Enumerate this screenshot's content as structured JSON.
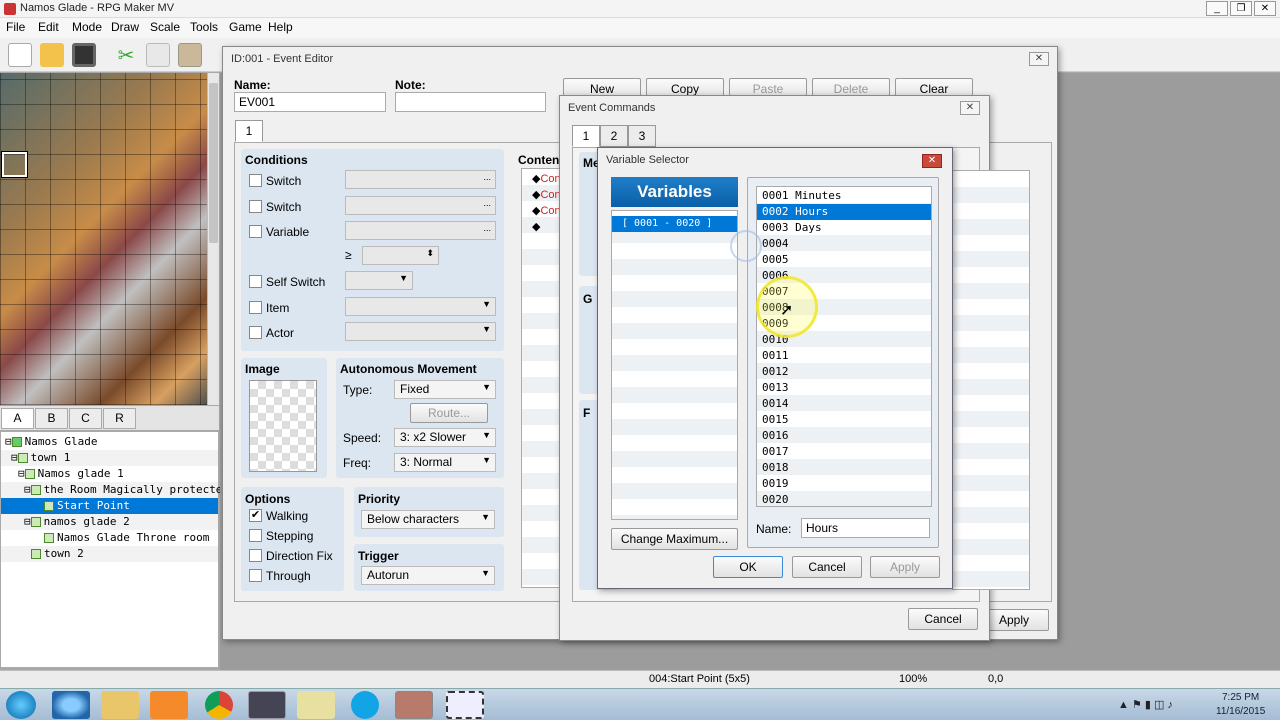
{
  "app": {
    "title": "Namos Glade - RPG Maker MV"
  },
  "menu": [
    "File",
    "Edit",
    "Mode",
    "Draw",
    "Scale",
    "Tools",
    "Game",
    "Help"
  ],
  "tileset_tabs": [
    "A",
    "B",
    "C",
    "R"
  ],
  "map_tree": [
    {
      "label": "Namos Glade",
      "depth": 0
    },
    {
      "label": "town 1",
      "depth": 1
    },
    {
      "label": "Namos glade 1",
      "depth": 2
    },
    {
      "label": "the Room Magically protected",
      "depth": 3
    },
    {
      "label": "Start Point",
      "depth": 4,
      "selected": true
    },
    {
      "label": "namos glade 2",
      "depth": 3
    },
    {
      "label": "Namos Glade Throne room",
      "depth": 4
    },
    {
      "label": "town 2",
      "depth": 2
    }
  ],
  "status": {
    "event": "004:Start Point (5x5)",
    "zoom": "100%",
    "coords": "0,0"
  },
  "clock": {
    "time": "7:25 PM",
    "date": "11/16/2015"
  },
  "event_editor": {
    "title": "ID:001 - Event Editor",
    "name_label": "Name:",
    "name_value": "EV001",
    "note_label": "Note:",
    "note_value": "",
    "buttons": {
      "new": "New",
      "copy": "Copy",
      "paste": "Paste",
      "delete": "Delete",
      "clear": "Clear"
    },
    "page_tab": "1",
    "conditions_title": "Conditions",
    "conditions": [
      "Switch",
      "Switch",
      "Variable",
      "Self Switch",
      "Item",
      "Actor"
    ],
    "ellipsis": "...",
    "gte": "≥",
    "image_title": "Image",
    "autonomous_title": "Autonomous Movement",
    "type_label": "Type:",
    "type_value": "Fixed",
    "route_button": "Route...",
    "speed_label": "Speed:",
    "speed_value": "3: x2 Slower",
    "freq_label": "Freq:",
    "freq_value": "3: Normal",
    "options_title": "Options",
    "options": [
      {
        "label": "Walking",
        "checked": true
      },
      {
        "label": "Stepping",
        "checked": false
      },
      {
        "label": "Direction Fix",
        "checked": false
      },
      {
        "label": "Through",
        "checked": false
      }
    ],
    "priority_title": "Priority",
    "priority_value": "Below characters",
    "trigger_title": "Trigger",
    "trigger_value": "Autorun",
    "contents_title": "Contents",
    "contents": [
      "Con",
      "Con",
      "Con",
      ""
    ],
    "apply_button": "Apply"
  },
  "event_commands": {
    "title": "Event Commands",
    "tabs": [
      "1",
      "2",
      "3"
    ],
    "section_labels": [
      "Me",
      "G",
      "F"
    ],
    "cancel_button": "Cancel"
  },
  "variable_selector": {
    "title": "Variable Selector",
    "header": "Variables",
    "groups": [
      "[ 0001 - 0020 ]"
    ],
    "change_max_button": "Change Maximum...",
    "items": [
      "0001 Minutes",
      "0002 Hours",
      "0003 Days",
      "0004",
      "0005",
      "0006",
      "0007",
      "0008",
      "0009",
      "0010",
      "0011",
      "0012",
      "0013",
      "0014",
      "0015",
      "0016",
      "0017",
      "0018",
      "0019",
      "0020"
    ],
    "selected_index": 1,
    "name_label": "Name:",
    "name_value": "Hours",
    "ok_button": "OK",
    "cancel_button": "Cancel",
    "apply_button": "Apply"
  }
}
